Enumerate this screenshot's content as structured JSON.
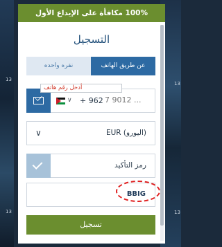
{
  "banner": {
    "text": "100% مكافأة على الإيداع الأول"
  },
  "background": {
    "numbers": [
      "13",
      "13",
      "13",
      "13"
    ]
  },
  "form": {
    "title": "التسجيل",
    "tabs": [
      {
        "label": "نقره واحده",
        "active": false
      },
      {
        "label": "عن طريق الهاتف",
        "active": true
      }
    ],
    "phone": {
      "country": "jordan-flag",
      "dial_code": "+ 962",
      "placeholder": "7 9012 ...",
      "tooltip": "أدخل رقم هاتف"
    },
    "currency": {
      "value": "EUR (اليورو)"
    },
    "confirmation": {
      "label": "رمز التأكيد"
    },
    "promo_code": {
      "value": "BBIG"
    },
    "submit_label": "تسجيل"
  },
  "colors": {
    "accent_green": "#6b8e2f",
    "accent_blue": "#2d6aa3",
    "annotation_red": "#e02020"
  }
}
